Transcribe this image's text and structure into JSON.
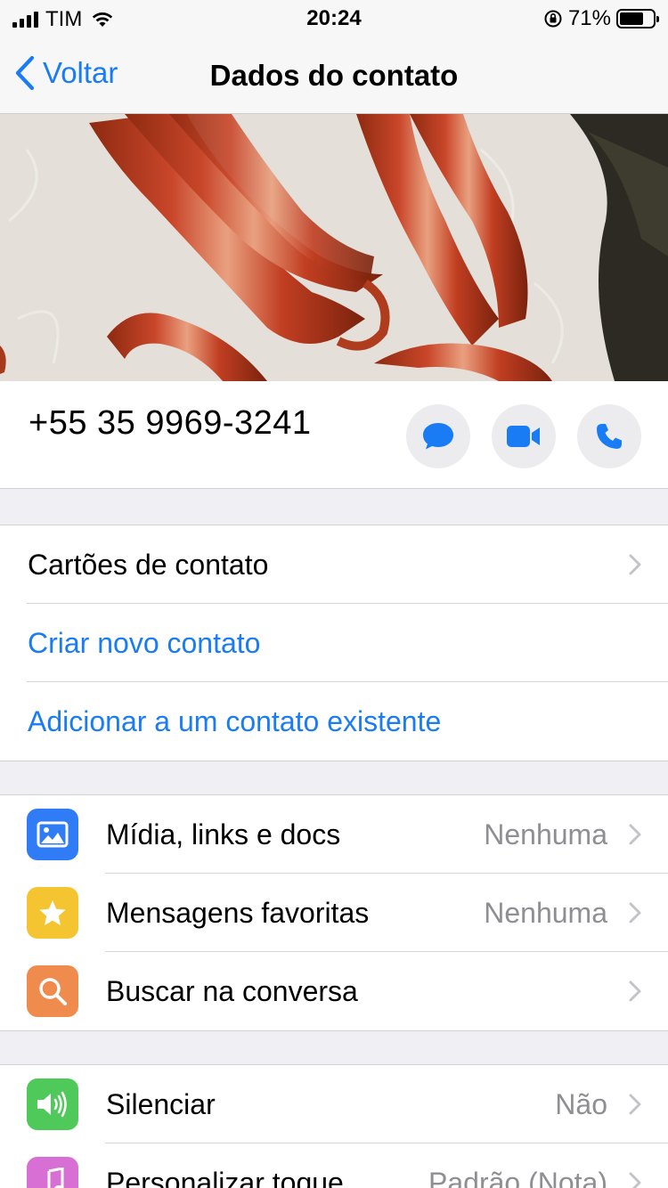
{
  "status_bar": {
    "carrier": "TIM",
    "time": "20:24",
    "battery_label": "71%",
    "battery_level": 0.71
  },
  "nav": {
    "back_label": "Voltar",
    "title": "Dados do contato"
  },
  "contact": {
    "phone": "+55 35 9969-3241",
    "actions": [
      "message-icon",
      "video-call-icon",
      "phone-call-icon"
    ]
  },
  "contact_actions": {
    "rows": [
      {
        "label": "Cartões de contato"
      },
      {
        "label": "Criar novo contato"
      },
      {
        "label": "Adicionar a um contato existente"
      }
    ]
  },
  "chat_info": {
    "rows": [
      {
        "label": "Mídia, links e docs",
        "value": "Nenhuma",
        "icon": "photo-icon",
        "color": "#2f7cf6"
      },
      {
        "label": "Mensagens favoritas",
        "value": "Nenhuma",
        "icon": "star-icon",
        "color": "#f5c531"
      },
      {
        "label": "Buscar na conversa",
        "value": "",
        "icon": "search-icon",
        "color": "#ef8c4d"
      }
    ]
  },
  "notifications": {
    "rows": [
      {
        "label": "Silenciar",
        "value": "Não",
        "icon": "speaker-icon",
        "color": "#4fc959"
      },
      {
        "label": "Personalizar toque",
        "value": "Padrão (Nota)",
        "icon": "music-note-icon",
        "color": "#d86fd4"
      }
    ]
  },
  "colors": {
    "accent": "#1a7cf5",
    "background": "#efeff4"
  }
}
